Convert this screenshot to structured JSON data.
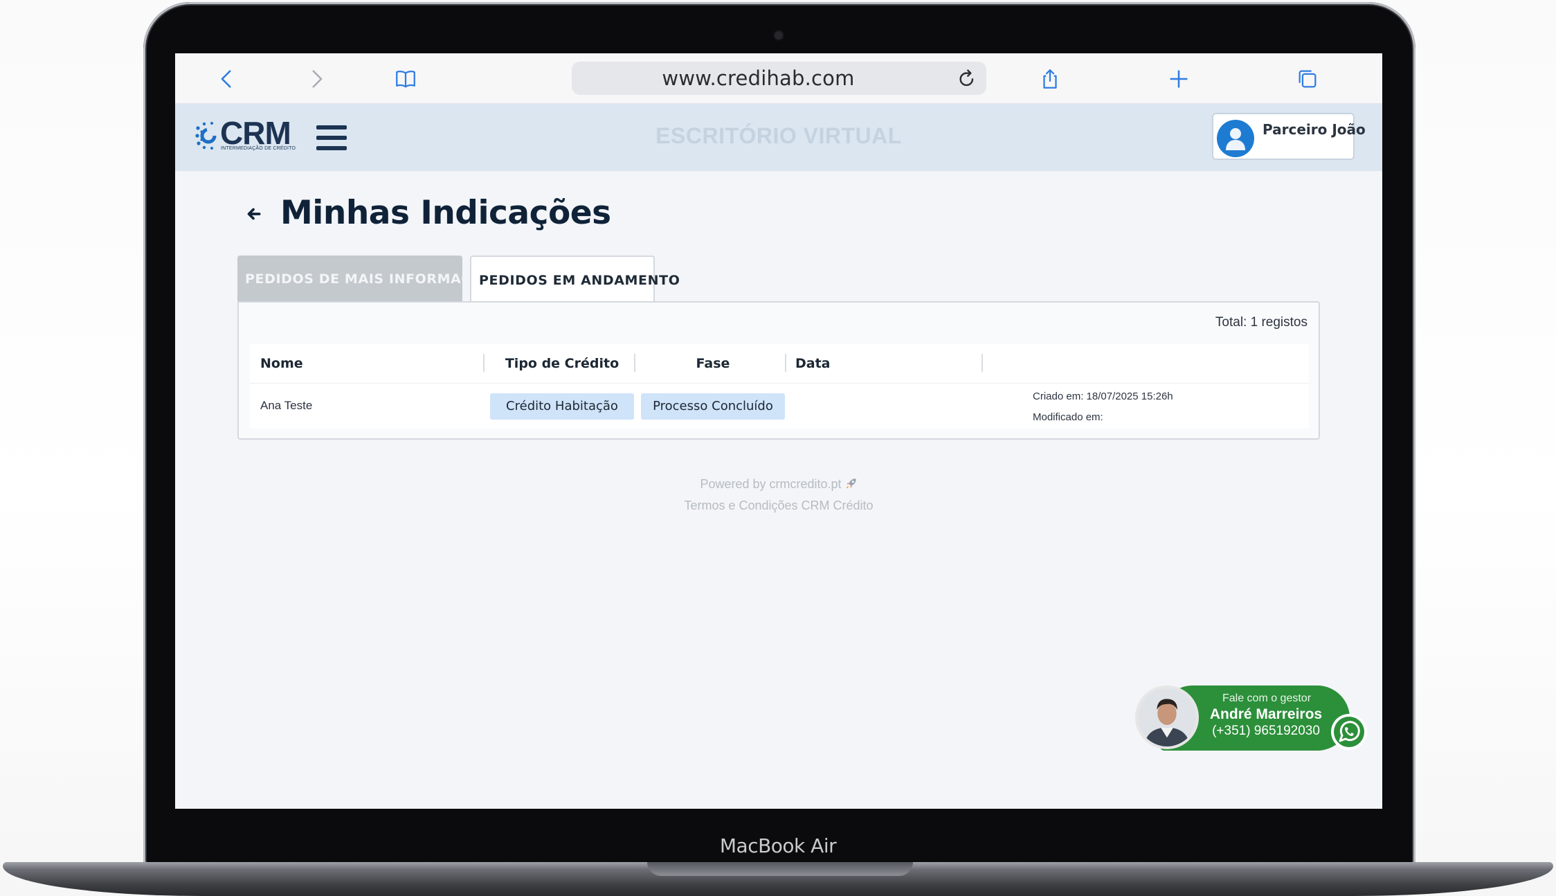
{
  "device": {
    "label": "MacBook Air"
  },
  "browser": {
    "url": "www.credihab.com",
    "icons": [
      "chevron-left-icon",
      "chevron-right-icon",
      "book-icon",
      "reload-icon",
      "share-icon",
      "plus-icon",
      "tabs-icon"
    ]
  },
  "header": {
    "logo_text": "CRM",
    "logo_subtitle": "INTERMEDIAÇÃO DE CRÉDITO",
    "title": "ESCRITÓRIO VIRTUAL",
    "user_name": "Parceiro João"
  },
  "page": {
    "title": "Minhas Indicações",
    "tabs": [
      {
        "label": "PEDIDOS DE MAIS INFORMAÇÃO",
        "active": false
      },
      {
        "label": "PEDIDOS EM ANDAMENTO",
        "active": true
      }
    ],
    "total": "Total: 1 registos"
  },
  "table": {
    "columns": [
      "Nome",
      "Tipo de Crédito",
      "Fase",
      "Data"
    ],
    "rows": [
      {
        "nome": "Ana Teste",
        "tipo_credito": "Crédito Habitação",
        "fase": "Processo Concluído",
        "criado": "Criado em: 18/07/2025 15:26h",
        "modificado": "Modificado em:"
      }
    ]
  },
  "footer": {
    "powered": "Powered by crmcredito.pt",
    "terms": "Termos e Condições CRM Crédito"
  },
  "contact": {
    "label": "Fale com o gestor",
    "name": "André Marreiros",
    "phone": "(+351) 965192030"
  },
  "colors": {
    "header_bg": "#dbe6f1",
    "brand_dark": "#1c3352",
    "pill_bg": "#cfe3f9",
    "whatsapp_green": "#2c8f3a",
    "avatar_blue": "#1e7bd2"
  }
}
